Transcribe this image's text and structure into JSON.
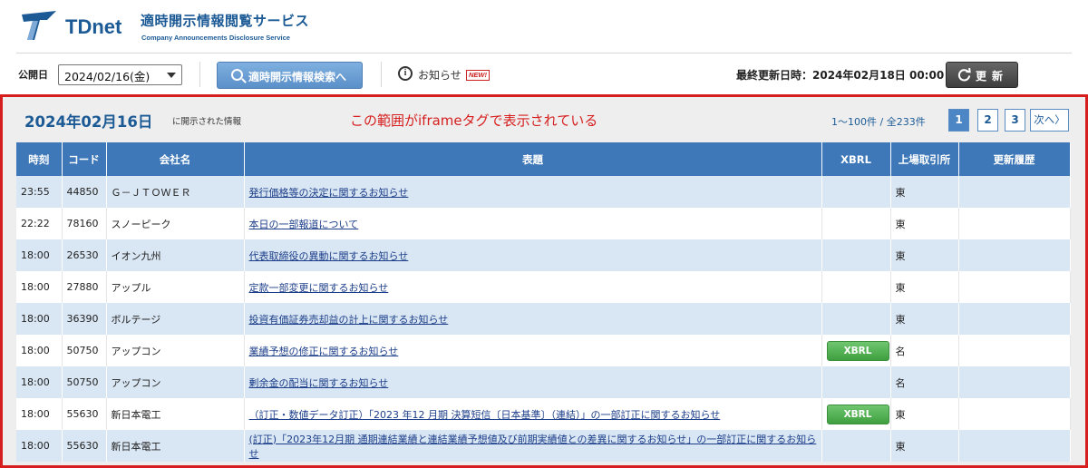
{
  "header": {
    "logo_text": "TDnet",
    "title": "適時開示情報閲覧サービス",
    "subtitle": "Company Announcements Disclosure Service"
  },
  "toolbar": {
    "date_label": "公開日",
    "date_value": "2024/02/16(金)",
    "search_label": "適時開示情報検索へ",
    "info_label": "お知らせ",
    "new_badge": "NEW!",
    "last_updated": "最終更新日時：2024年02月18日 00:00",
    "refresh_label": "更新"
  },
  "frame": {
    "date_heading": "2024年02月16日",
    "date_sub": "に開示された情報",
    "note": "この範囲がiframeタグで表示されている",
    "range": "1～100件 / 全233件",
    "pages": [
      "1",
      "2",
      "3"
    ],
    "next_label": "次へ〉"
  },
  "table": {
    "headers": [
      "時刻",
      "コード",
      "会社名",
      "表題",
      "XBRL",
      "上場取引所",
      "更新履歴"
    ],
    "xbrl_label": "XBRL",
    "rows": [
      {
        "time": "23:55",
        "code": "44850",
        "company": "Ｇ－ＪＴＯＷＥＲ",
        "title": "発行価格等の決定に関するお知らせ",
        "xbrl": false,
        "exchange": "東",
        "history": ""
      },
      {
        "time": "22:22",
        "code": "78160",
        "company": "スノーピーク",
        "title": "本日の一部報道について",
        "xbrl": false,
        "exchange": "東",
        "history": ""
      },
      {
        "time": "18:00",
        "code": "26530",
        "company": "イオン九州",
        "title": "代表取締役の異動に関するお知らせ",
        "xbrl": false,
        "exchange": "東",
        "history": ""
      },
      {
        "time": "18:00",
        "code": "27880",
        "company": "アップル",
        "title": "定款一部変更に関するお知らせ",
        "xbrl": false,
        "exchange": "東",
        "history": ""
      },
      {
        "time": "18:00",
        "code": "36390",
        "company": "ボルテージ",
        "title": "投資有価証券売却益の計上に関するお知らせ",
        "xbrl": false,
        "exchange": "東",
        "history": ""
      },
      {
        "time": "18:00",
        "code": "50750",
        "company": "アップコン",
        "title": "業績予想の修正に関するお知らせ",
        "xbrl": true,
        "exchange": "名",
        "history": ""
      },
      {
        "time": "18:00",
        "code": "50750",
        "company": "アップコン",
        "title": "剰余金の配当に関するお知らせ",
        "xbrl": false,
        "exchange": "名",
        "history": ""
      },
      {
        "time": "18:00",
        "code": "55630",
        "company": "新日本電工",
        "title": "（訂正・数値データ訂正）「2023 年12 月期 決算短信〔日本基準〕（連結）」の一部訂正に関するお知らせ",
        "xbrl": true,
        "exchange": "東",
        "history": ""
      },
      {
        "time": "18:00",
        "code": "55630",
        "company": "新日本電工",
        "title": "(訂正)「2023年12月期 通期連結業績と連結業績予想値及び前期実績値との差異に関するお知らせ」の一部訂正に関するお知らせ",
        "xbrl": false,
        "exchange": "東",
        "history": ""
      }
    ]
  }
}
